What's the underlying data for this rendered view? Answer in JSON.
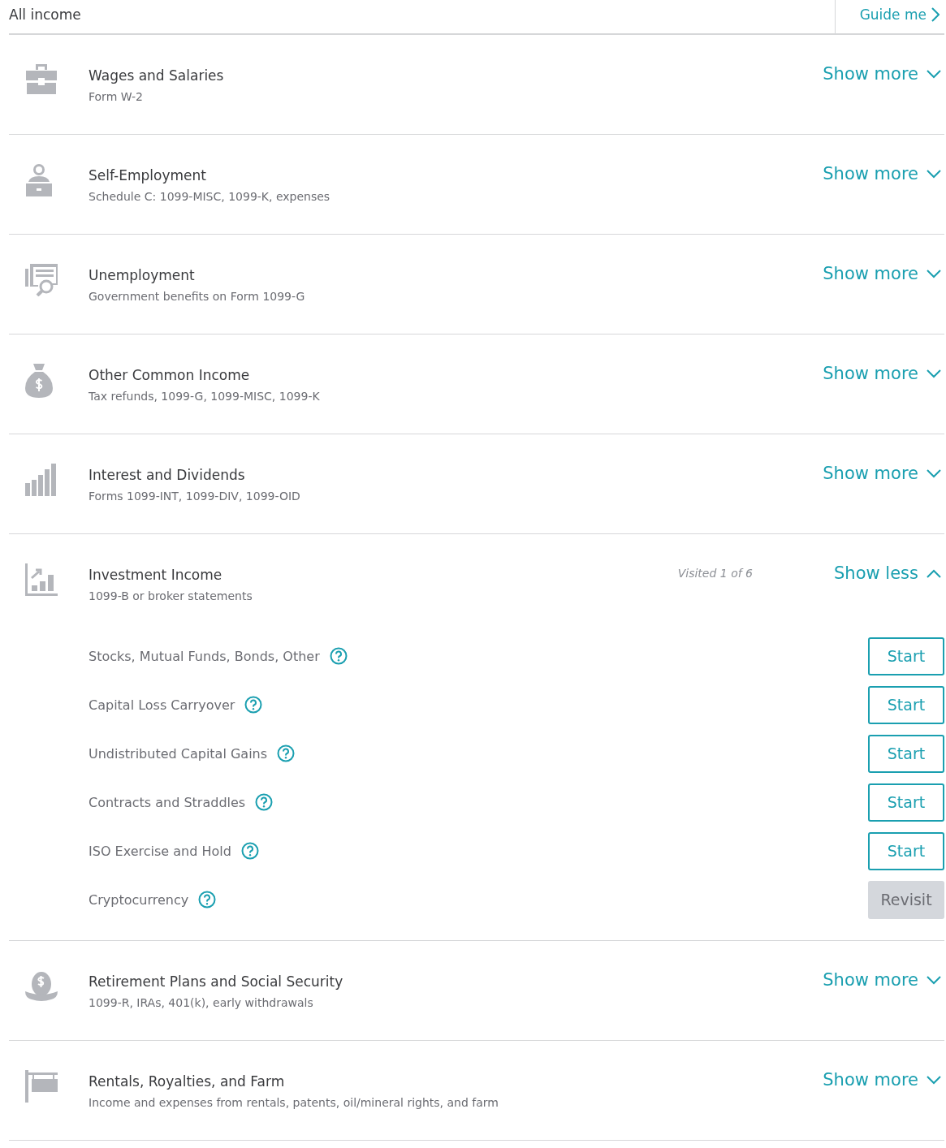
{
  "header": {
    "title": "All income",
    "guide": "Guide me"
  },
  "sections": [
    {
      "title": "Wages and Salaries",
      "subtitle": "Form W-2",
      "toggle": "Show more",
      "expanded": false
    },
    {
      "title": "Self-Employment",
      "subtitle": "Schedule C: 1099-MISC, 1099-K, expenses",
      "toggle": "Show more",
      "expanded": false
    },
    {
      "title": "Unemployment",
      "subtitle": "Government benefits on Form 1099-G",
      "toggle": "Show more",
      "expanded": false
    },
    {
      "title": "Other Common Income",
      "subtitle": "Tax refunds, 1099-G, 1099-MISC, 1099-K",
      "toggle": "Show more",
      "expanded": false
    },
    {
      "title": "Interest and Dividends",
      "subtitle": "Forms 1099-INT, 1099-DIV, 1099-OID",
      "toggle": "Show more",
      "expanded": false
    },
    {
      "title": "Investment Income",
      "subtitle": "1099-B or broker statements",
      "visited": "Visited 1 of 6",
      "toggle": "Show less",
      "expanded": true,
      "items": [
        {
          "label": "Stocks, Mutual Funds, Bonds, Other",
          "action": {
            "text": "Start",
            "kind": "start"
          }
        },
        {
          "label": "Capital Loss Carryover",
          "action": {
            "text": "Start",
            "kind": "start"
          }
        },
        {
          "label": "Undistributed Capital Gains",
          "action": {
            "text": "Start",
            "kind": "start"
          }
        },
        {
          "label": "Contracts and Straddles",
          "action": {
            "text": "Start",
            "kind": "start"
          }
        },
        {
          "label": "ISO Exercise and Hold",
          "action": {
            "text": "Start",
            "kind": "start"
          }
        },
        {
          "label": "Cryptocurrency",
          "action": {
            "text": "Revisit",
            "kind": "revisit"
          }
        }
      ]
    },
    {
      "title": "Retirement Plans and Social Security",
      "subtitle": "1099-R, IRAs, 401(k), early withdrawals",
      "toggle": "Show more",
      "expanded": false
    },
    {
      "title": "Rentals, Royalties, and Farm",
      "subtitle": "Income and expenses from rentals, patents, oil/mineral rights, and farm",
      "toggle": "Show more",
      "expanded": false
    }
  ]
}
